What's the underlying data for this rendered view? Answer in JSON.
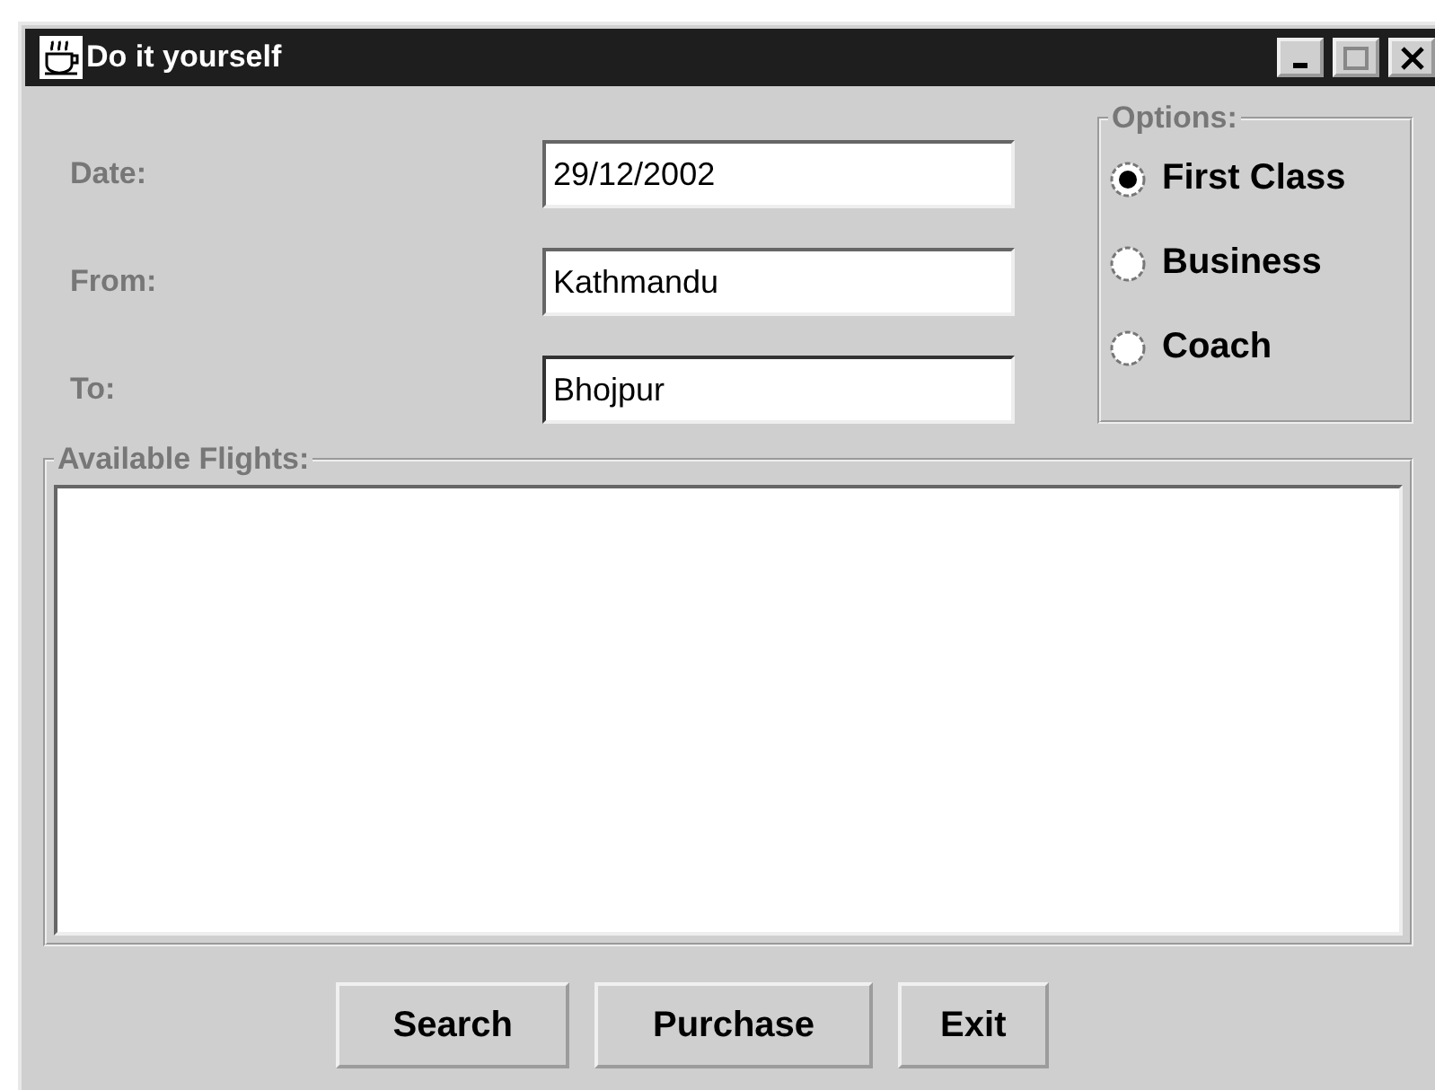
{
  "window": {
    "title": "Do it yourself"
  },
  "fields": [
    {
      "label": "Date:",
      "value": "29/12/2002",
      "focused": false
    },
    {
      "label": "From:",
      "value": "Kathmandu",
      "focused": false
    },
    {
      "label": "To:",
      "value": "Bhojpur",
      "focused": true
    }
  ],
  "options": {
    "title": "Options:",
    "items": [
      {
        "label": "First Class",
        "selected": true
      },
      {
        "label": "Business",
        "selected": false
      },
      {
        "label": "Coach",
        "selected": false
      }
    ]
  },
  "flights": {
    "title": "Available Flights:"
  },
  "buttons": [
    "Search",
    "Purchase",
    "Exit"
  ]
}
